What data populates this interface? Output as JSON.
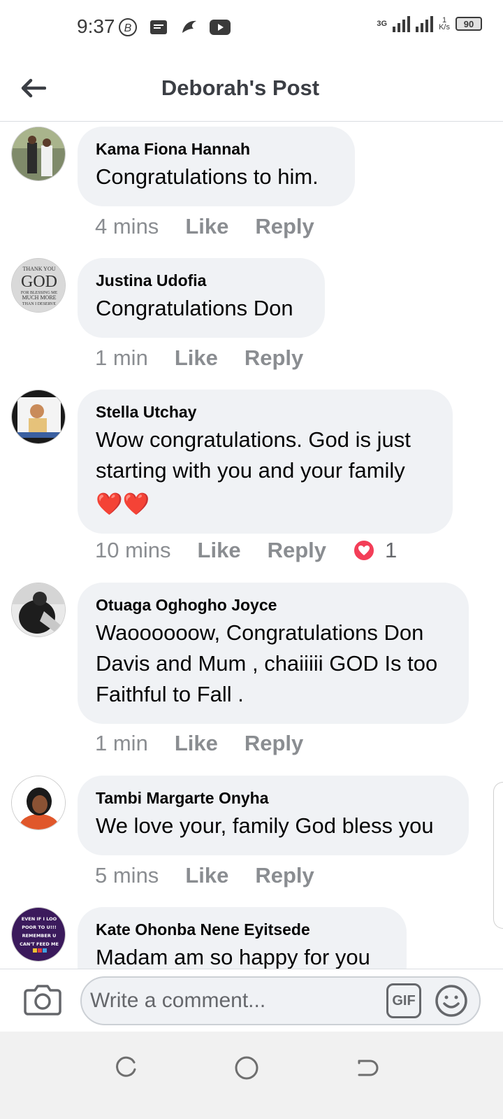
{
  "status_bar": {
    "time": "9:37",
    "network_type": "3G",
    "speed_value": "1",
    "speed_unit": "K/s",
    "battery": "90"
  },
  "header": {
    "title": "Deborah's Post"
  },
  "comments": [
    {
      "name": "Kama Fiona Hannah",
      "text": "Congratulations to him.",
      "time": "4 mins",
      "like": "Like",
      "reply": "Reply"
    },
    {
      "name": "Justina Udofia",
      "text": "Congratulations Don",
      "time": "1 min",
      "like": "Like",
      "reply": "Reply",
      "avatar_text": [
        "THANK YOU",
        "GOD",
        "FOR BLESSING ME",
        "MUCH MORE",
        "THAN I DESERVE"
      ]
    },
    {
      "name": "Stella Utchay",
      "text": "Wow congratulations. God is just starting with you and your family",
      "emoji": "❤️❤️",
      "time": "10 mins",
      "like": "Like",
      "reply": "Reply",
      "reaction_count": "1"
    },
    {
      "name": "Otuaga Oghogho Joyce",
      "text": "Waoooooow, Congratulations Don Davis and Mum , chaiiiii GOD Is too Faithful to Fall .",
      "time": "1 min",
      "like": "Like",
      "reply": "Reply"
    },
    {
      "name": "Tambi Margarte Onyha",
      "text": "We love your, family God bless you",
      "time": "5 mins",
      "like": "Like",
      "reply": "Reply"
    },
    {
      "name": "Kate Ohonba Nene Eyitsede",
      "text": "Madam am so happy for you",
      "avatar_text": [
        "EVEN IF I LOO",
        "POOR TO U!!!",
        "REMEMBER U",
        "CAN'T FEED ME"
      ]
    }
  ],
  "composer": {
    "placeholder": "Write a comment...",
    "gif_label": "GIF"
  },
  "colors": {
    "bubble": "#f0f2f5",
    "meta_text": "#8a8d91",
    "heart": "#f33e58"
  }
}
